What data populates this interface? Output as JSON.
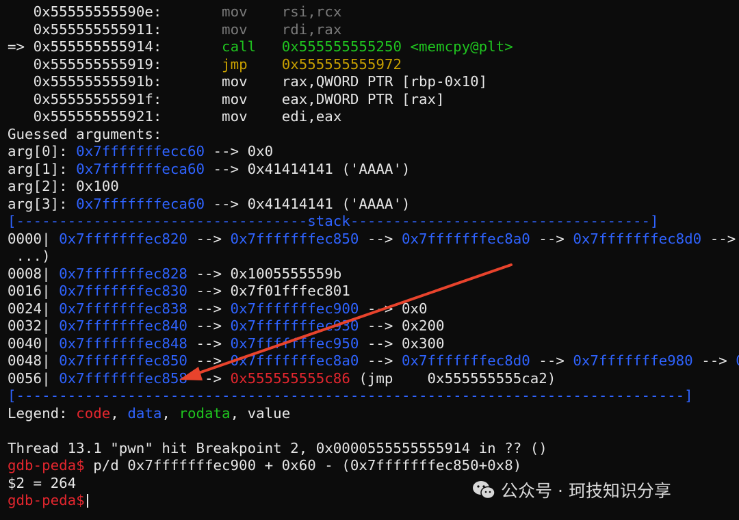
{
  "disasm": [
    {
      "marker": "  ",
      "addr": "0x55555555590e:",
      "mnem": "mov",
      "ops": "rsi,rcx",
      "color": "dim"
    },
    {
      "marker": "  ",
      "addr": "0x555555555911:",
      "mnem": "mov",
      "ops": "rdi,rax",
      "color": "dim"
    },
    {
      "marker": "=>",
      "addr": "0x555555555914:",
      "mnem": "call",
      "ops": "0x555555555250 <memcpy@plt>",
      "color": "green"
    },
    {
      "marker": "  ",
      "addr": "0x555555555919:",
      "mnem": "jmp",
      "ops": "0x555555555972",
      "color": "yellow"
    },
    {
      "marker": "  ",
      "addr": "0x55555555591b:",
      "mnem": "mov",
      "ops": "rax,QWORD PTR [rbp-0x10]",
      "color": "w"
    },
    {
      "marker": "  ",
      "addr": "0x55555555591f:",
      "mnem": "mov",
      "ops": "eax,DWORD PTR [rax]",
      "color": "w"
    },
    {
      "marker": "  ",
      "addr": "0x555555555921:",
      "mnem": "mov",
      "ops": "edi,eax",
      "color": "w"
    }
  ],
  "guessed_header": "Guessed arguments:",
  "args": [
    {
      "label": "arg[0]: ",
      "ptr": "0x7fffffffecc60",
      "rest": " --> 0x0"
    },
    {
      "label": "arg[1]: ",
      "ptr": "0x7fffffffeca60",
      "rest": " --> 0x41414141 ('AAAA')"
    },
    {
      "label": "arg[2]: 0x100",
      "ptr": "",
      "rest": ""
    },
    {
      "label": "arg[3]: ",
      "ptr": "0x7fffffffeca60",
      "rest": " --> 0x41414141 ('AAAA')"
    }
  ],
  "stack_header": "[----------------------------------stack-----------------------------------]",
  "stack": [
    {
      "off": "0000| ",
      "segs": [
        [
          "blue",
          "0x7fffffffec820"
        ],
        [
          "w",
          " --> "
        ],
        [
          "blue",
          "0x7fffffffec850"
        ],
        [
          "w",
          " --> "
        ],
        [
          "blue",
          "0x7fffffffec8a0"
        ],
        [
          "w",
          " --> "
        ],
        [
          "blue",
          "0x7fffffffec8d0"
        ],
        [
          "w",
          " --> "
        ],
        [
          "blue",
          "0x7fffffffe"
        ]
      ]
    },
    {
      "off": " ...)",
      "segs": []
    },
    {
      "off": "0008| ",
      "segs": [
        [
          "blue",
          "0x7fffffffec828"
        ],
        [
          "w",
          " --> 0x1005555559b"
        ]
      ]
    },
    {
      "off": "0016| ",
      "segs": [
        [
          "blue",
          "0x7fffffffec830"
        ],
        [
          "w",
          " --> 0x7f01fffec801"
        ]
      ]
    },
    {
      "off": "0024| ",
      "segs": [
        [
          "blue",
          "0x7fffffffec838"
        ],
        [
          "w",
          " --> "
        ],
        [
          "blue",
          "0x7fffffffec900"
        ],
        [
          "w",
          " --> 0x0"
        ]
      ]
    },
    {
      "off": "0032| ",
      "segs": [
        [
          "blue",
          "0x7fffffffec840"
        ],
        [
          "w",
          " --> "
        ],
        [
          "blue",
          "0x7fffffffec930"
        ],
        [
          "w",
          " --> 0x200"
        ]
      ]
    },
    {
      "off": "0040| ",
      "segs": [
        [
          "blue",
          "0x7fffffffec848"
        ],
        [
          "w",
          " --> "
        ],
        [
          "blue",
          "0x7fffffffec950"
        ],
        [
          "w",
          " --> 0x300"
        ]
      ]
    },
    {
      "off": "0048| ",
      "segs": [
        [
          "blue",
          "0x7fffffffec850"
        ],
        [
          "w",
          " --> "
        ],
        [
          "blue",
          "0x7fffffffec8a0"
        ],
        [
          "w",
          " --> "
        ],
        [
          "blue",
          "0x7fffffffec8d0"
        ],
        [
          "w",
          " --> "
        ],
        [
          "blue",
          "0x7fffffffe980"
        ],
        [
          "w",
          " --> "
        ],
        [
          "blue",
          "0x7fffffffe"
        ]
      ]
    },
    {
      "off": "0056| ",
      "segs": [
        [
          "blue",
          "0x7fffffffec858"
        ],
        [
          "w",
          " --> "
        ],
        [
          "red",
          "0x555555555c86"
        ],
        [
          "w",
          " (jmp    0x555555555ca2)"
        ]
      ]
    }
  ],
  "stack_footer": "[------------------------------------------------------------------------------]",
  "legend": {
    "label": "Legend: ",
    "code": "code",
    "data": "data",
    "rodata": "rodata",
    "value": "value",
    "sep": ", "
  },
  "thread_line": "Thread 13.1 \"pwn\" hit Breakpoint 2, 0x0000555555555914 in ?? ()",
  "prompt": "gdb-peda$",
  "command": " p/d 0x7fffffffec900 + 0x60 - (0x7fffffffec850+0x8)",
  "result": "$2 = 264",
  "watermark": "公众号 · 珂技知识分享",
  "colors": {
    "code": "#e3262e",
    "data": "#2f63ff",
    "rodata": "#1fc41f",
    "arrow": "#e8432c"
  }
}
